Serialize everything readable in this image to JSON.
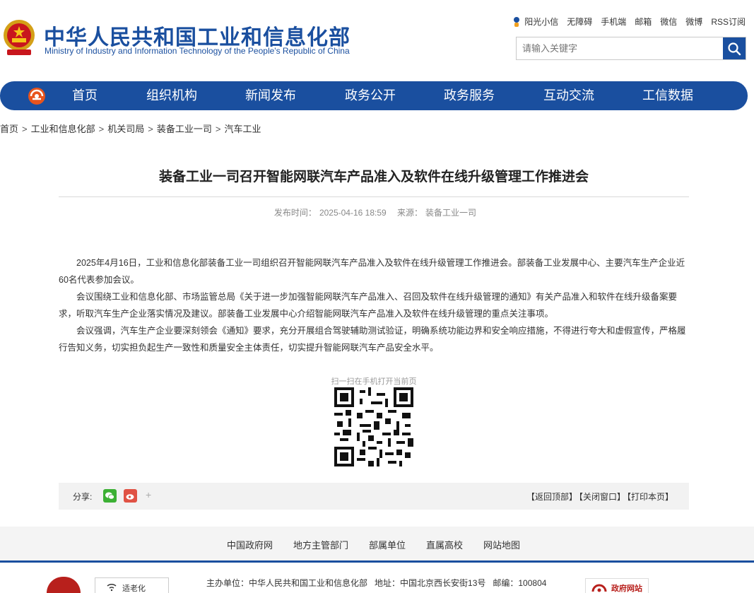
{
  "header": {
    "title": "中华人民共和国工业和信息化部",
    "subtitle": "Ministry of Industry and Information Technology of the People's Republic of China",
    "top_links": [
      "阳光小信",
      "无障碍",
      "手机端",
      "邮箱",
      "微信",
      "微博",
      "RSS订阅"
    ],
    "search_placeholder": "请输入关键字",
    "brand_color": "#1a4f9f"
  },
  "nav": {
    "items": [
      "首页",
      "组织机构",
      "新闻发布",
      "政务公开",
      "政务服务",
      "互动交流",
      "工信数据"
    ]
  },
  "breadcrumb": [
    "首页",
    "工业和信息化部",
    "机关司局",
    "装备工业一司",
    "汽车工业"
  ],
  "article": {
    "title": "装备工业一司召开智能网联汽车产品准入及软件在线升级管理工作推进会",
    "publish_label": "发布时间：",
    "publish_time": "2025-04-16 18:59",
    "source_label": "来源：",
    "source": "装备工业一司",
    "paragraphs": [
      "2025年4月16日，工业和信息化部装备工业一司组织召开智能网联汽车产品准入及软件在线升级管理工作推进会。部装备工业发展中心、主要汽车生产企业近60名代表参加会议。",
      "会议围绕工业和信息化部、市场监管总局《关于进一步加强智能网联汽车产品准入、召回及软件在线升级管理的通知》有关产品准入和软件在线升级备案要求，听取汽车生产企业落实情况及建议。部装备工业发展中心介绍智能网联汽车产品准入及软件在线升级管理的重点关注事项。",
      "会议强调，汽车生产企业要深刻领会《通知》要求，充分开展组合驾驶辅助测试验证，明确系统功能边界和安全响应措施，不得进行夸大和虚假宣传，严格履行告知义务，切实担负起生产一致性和质量安全主体责任，切实提升智能网联汽车产品安全水平。"
    ],
    "qr_caption": "扫一扫在手机打开当前页"
  },
  "share": {
    "label": "分享:",
    "more": "+",
    "back_top": "【返回顶部】",
    "close_window": "【关闭窗口】",
    "print": "【打印本页】"
  },
  "footer": {
    "links": [
      "中国政府网",
      "地方主管部门",
      "部属单位",
      "直属高校",
      "网站地图"
    ],
    "elderly_badge": "适老化",
    "sponsor": "主办单位：中华人民共和国工业和信息化部",
    "address": "地址：中国北京西长安街13号",
    "postcode": "邮编：100804",
    "gov_badge": "政府网站"
  }
}
